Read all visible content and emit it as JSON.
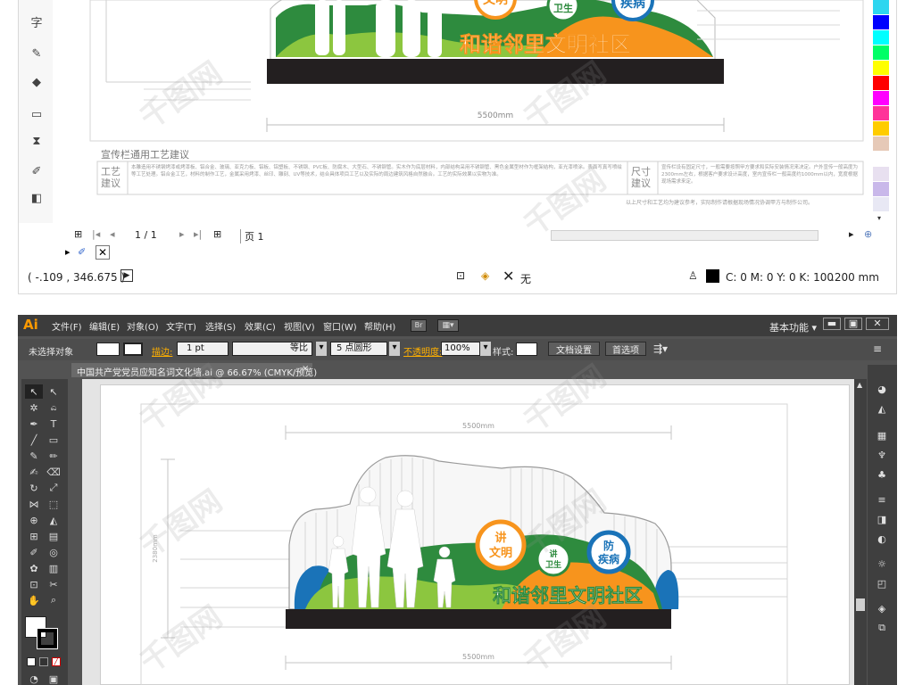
{
  "corel": {
    "toolbox": [
      "字"
    ],
    "sign_title": "和谐邻里文明社区",
    "badge_top_left": "文明",
    "badge_top_mid": "卫生",
    "badge_top_right": "疾病",
    "dimension_width": "5500mm",
    "craft_heading": "宣传栏通用工艺建议",
    "craft_label": "工艺\n建议",
    "size_label": "尺寸\n建议",
    "craft_text": "本雕造用不锈钢烤漆或烤漆板、铝合金、玻璃、亚克力板、铝板、铝塑板、不锈钢、PVC板、防腐木、大型石、不锈钢管。实木作为底层材料，内部结构采用不锈钢管、黑色金属型材作为框架结构，亚光漆喷涂。表面写真写喷绘等工艺处理。铝合金工艺，材料的制作工艺，金属采用烤漆、丝印、雕刻、UV等技术，结合具体项目工艺以及实际的周边建筑风格自然融合。工艺的实际效果以实物为准。",
    "size_text": "宣传栏设有固定尺寸，一般需要按照甲方要求和实际安装情况来决定。户外宣传一般高度为2300mm左右，根据客户要求设计高度，室内宣传栏一般高度约1000mm以内，宽度根据现场需求来定。",
    "footnote": "以上尺寸和工艺均为建议参考，实际制作请根据现场情况协调甲方与制作公司。",
    "page_indicator": "1 / 1",
    "page_tab": "页 1",
    "coordinates": "( -.109 , 346.675 )",
    "fill_label": "无",
    "color_readout": "C: 0 M: 0 Y: 0 K: 100",
    "stroke_width": ".200 mm",
    "palette": [
      "#2dd6f0",
      "#0000ff",
      "#00ffff",
      "#00ff66",
      "#ffff00",
      "#ff0000",
      "#ff00ff",
      "#ff3399",
      "#ffcc00",
      "#e6c9b7",
      "#ffffff",
      "#e8e0f0",
      "#c9b8ea",
      "#e8e8f4"
    ]
  },
  "ai": {
    "logo": "Ai",
    "menu": [
      "文件(F)",
      "编辑(E)",
      "对象(O)",
      "文字(T)",
      "选择(S)",
      "效果(C)",
      "视图(V)",
      "窗口(W)",
      "帮助(H)"
    ],
    "menu_badge": "Br",
    "workspace": "基本功能",
    "control": {
      "no_selection": "未选择对象",
      "stroke_label": "描边:",
      "stroke_value": "1 pt",
      "line_style": "等比",
      "brush": "5 点圆形",
      "opacity_label": "不透明度:",
      "opacity_value": "100%",
      "style_label": "样式:",
      "doc_setup": "文档设置",
      "preferences": "首选项"
    },
    "doc_tab": "中国共产党党员应知名词文化墙.ai @ 66.67% (CMYK/预览)",
    "doc_tab_close": "×",
    "sign": {
      "title": "和谐邻里文明社区",
      "badge_left_line1": "讲",
      "badge_left_line2": "文明",
      "badge_mid_line1": "讲",
      "badge_mid_line2": "卫生",
      "badge_right_line1": "防",
      "badge_right_line2": "疾病",
      "dimension_top": "5500mm",
      "dimension_bottom": "5500mm",
      "dimension_height": "2380mm"
    }
  },
  "watermark": "千图网",
  "colors": {
    "green_dark": "#2e8b3e",
    "green_light": "#8cc63f",
    "orange": "#f7941d",
    "blue": "#1a73b8",
    "black": "#231f20"
  }
}
